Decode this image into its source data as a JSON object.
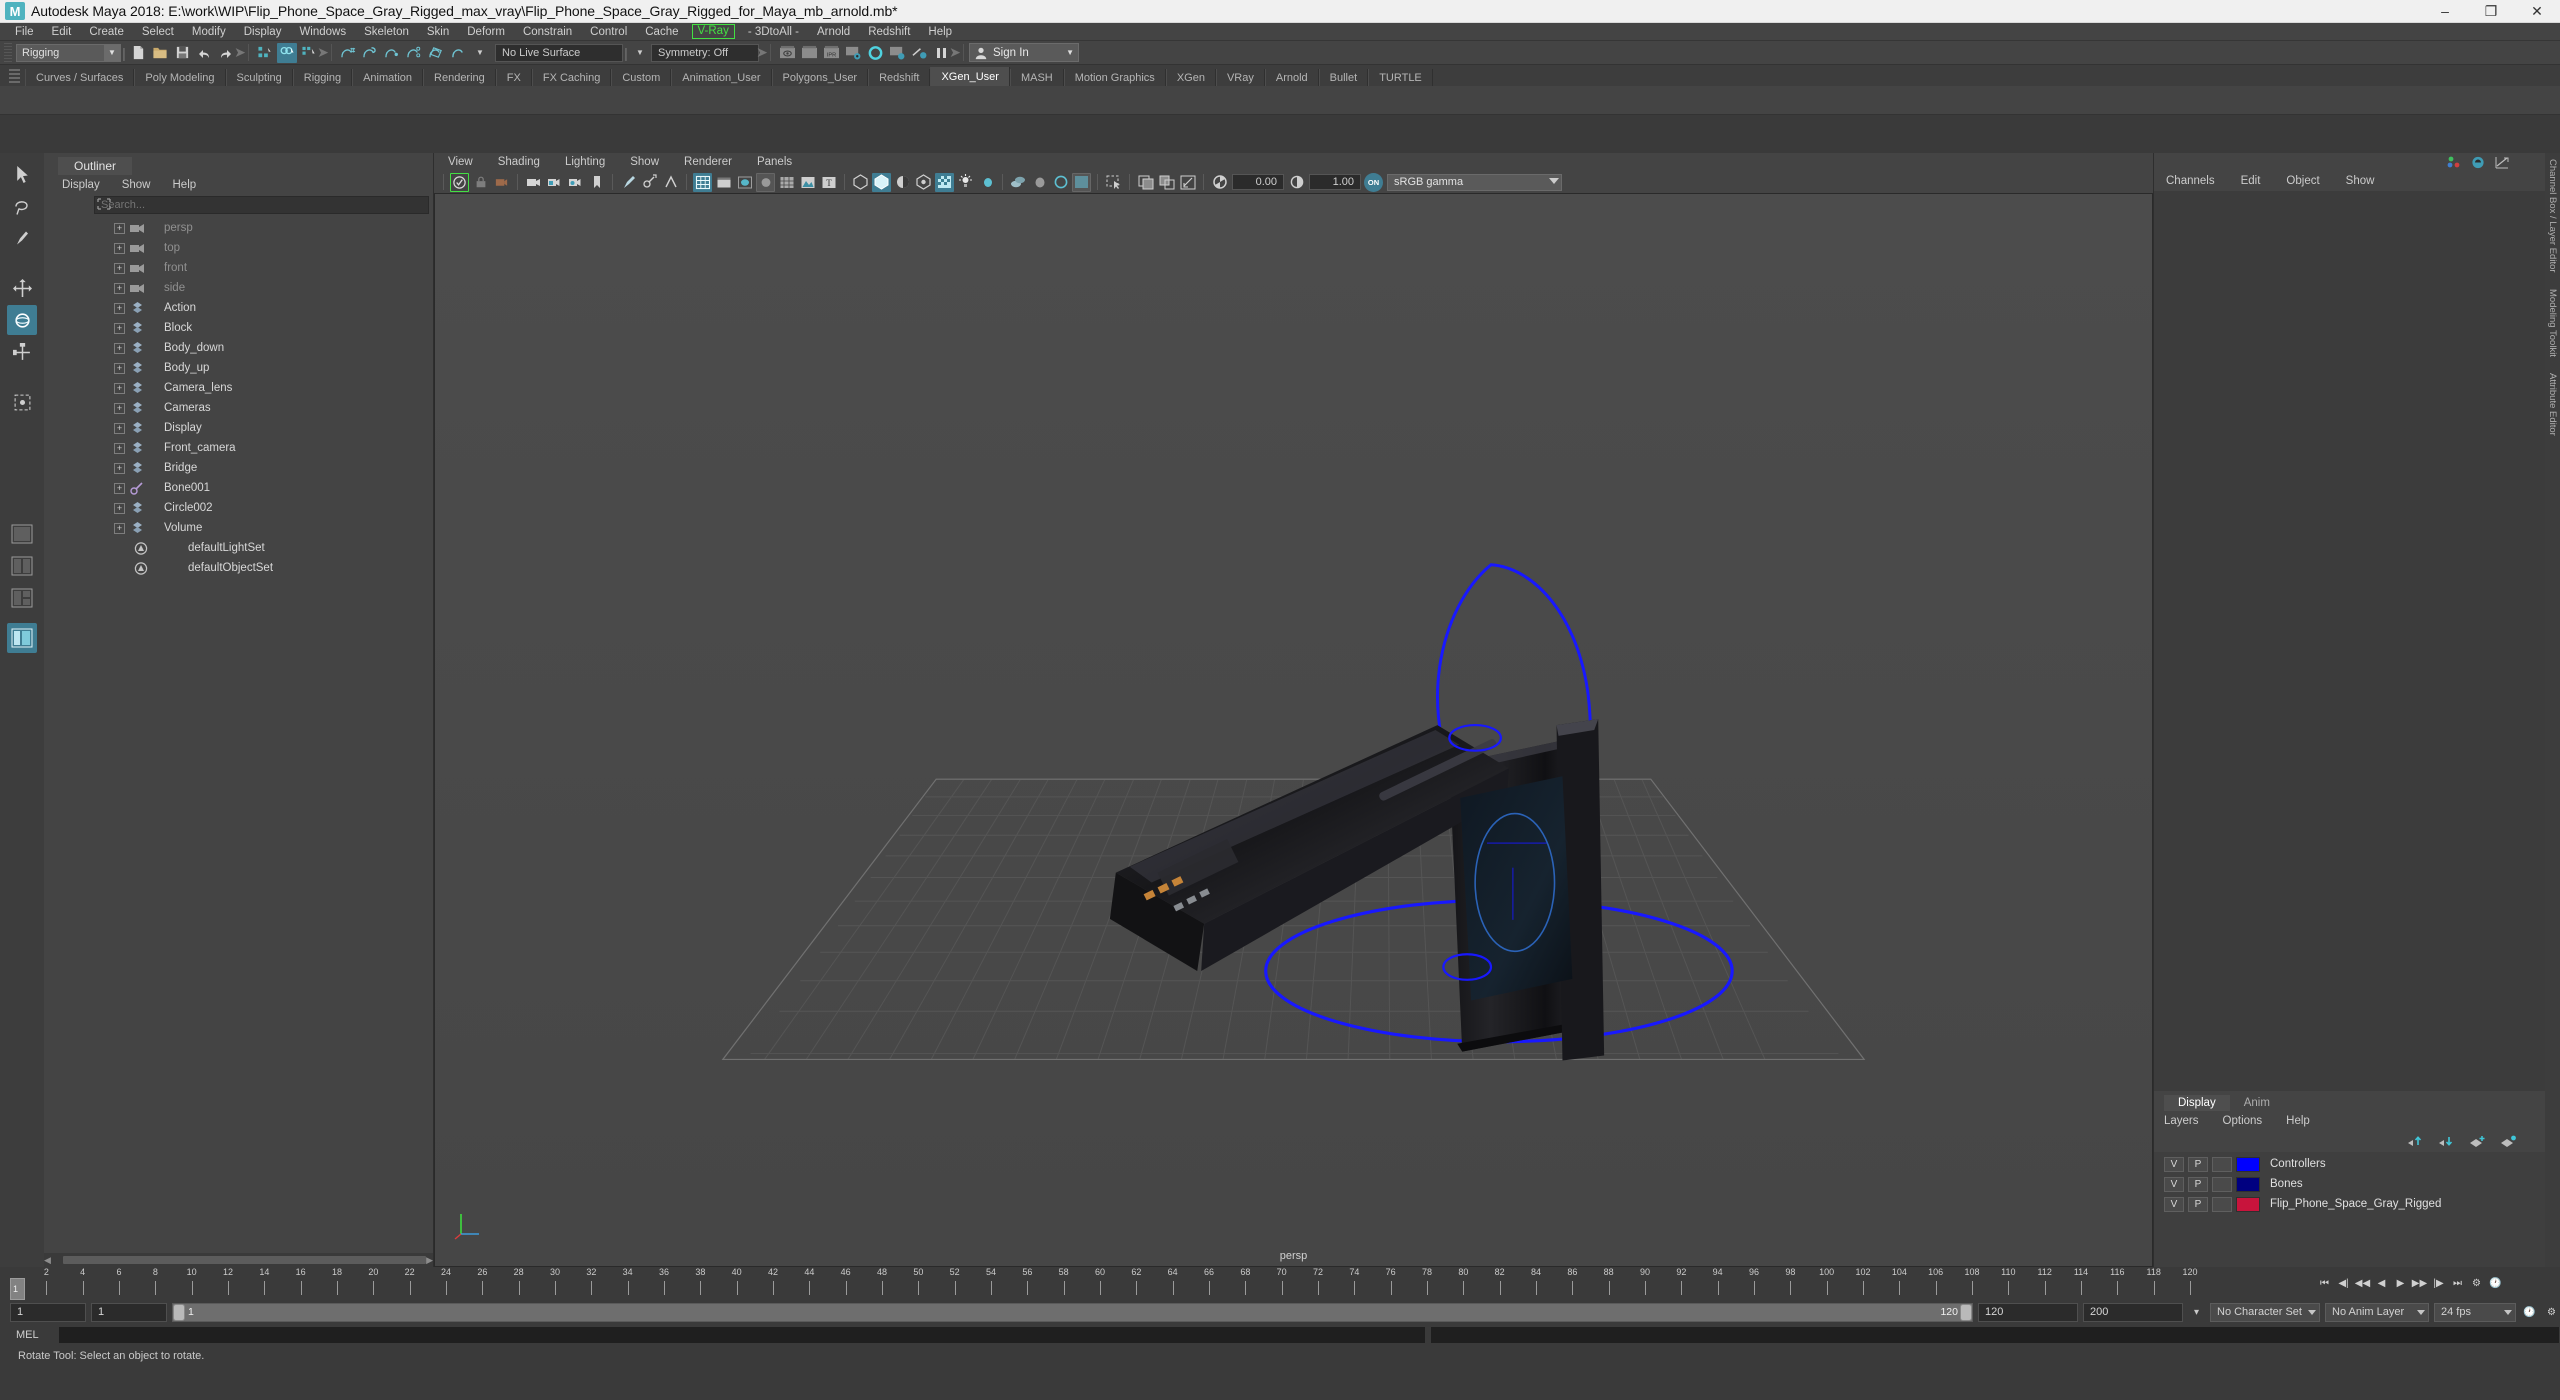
{
  "window": {
    "app_icon": "M",
    "title": "Autodesk Maya 2018: E:\\work\\WIP\\Flip_Phone_Space_Gray_Rigged_max_vray\\Flip_Phone_Space_Gray_Rigged_for_Maya_mb_arnold.mb*",
    "minimize": "–",
    "maximize": "❐",
    "close": "✕"
  },
  "menubar": [
    {
      "label": "File"
    },
    {
      "label": "Edit"
    },
    {
      "label": "Create"
    },
    {
      "label": "Select"
    },
    {
      "label": "Modify"
    },
    {
      "label": "Display"
    },
    {
      "label": "Windows"
    },
    {
      "label": "Skeleton"
    },
    {
      "label": "Skin"
    },
    {
      "label": "Deform"
    },
    {
      "label": "Constrain"
    },
    {
      "label": "Control"
    },
    {
      "label": "Cache"
    },
    {
      "label": "V-Ray",
      "style": "vray"
    },
    {
      "label": "- 3DtoAll -"
    },
    {
      "label": "Arnold"
    },
    {
      "label": "Redshift"
    },
    {
      "label": "Help"
    }
  ],
  "statusbar": {
    "menuset": "Rigging",
    "live_surface": "No Live Surface",
    "symmetry": "Symmetry: Off",
    "signin": "Sign In"
  },
  "shelf": {
    "tabs": [
      {
        "label": "Curves / Surfaces"
      },
      {
        "label": "Poly Modeling"
      },
      {
        "label": "Sculpting"
      },
      {
        "label": "Rigging"
      },
      {
        "label": "Animation"
      },
      {
        "label": "Rendering"
      },
      {
        "label": "FX"
      },
      {
        "label": "FX Caching"
      },
      {
        "label": "Custom"
      },
      {
        "label": "Animation_User"
      },
      {
        "label": "Polygons_User"
      },
      {
        "label": "Redshift"
      },
      {
        "label": "XGen_User",
        "active": true
      },
      {
        "label": "MASH"
      },
      {
        "label": "Motion Graphics"
      },
      {
        "label": "XGen"
      },
      {
        "label": "VRay"
      },
      {
        "label": "Arnold"
      },
      {
        "label": "Bullet"
      },
      {
        "label": "TURTLE"
      }
    ]
  },
  "outliner": {
    "tab": "Outliner",
    "menus": [
      "Display",
      "Show",
      "Help"
    ],
    "search_placeholder": "Search...",
    "items": [
      {
        "label": "persp",
        "icon": "camera-icon",
        "dim": true,
        "expandable": true
      },
      {
        "label": "top",
        "icon": "camera-icon",
        "dim": true,
        "expandable": true
      },
      {
        "label": "front",
        "icon": "camera-icon",
        "dim": true,
        "expandable": true
      },
      {
        "label": "side",
        "icon": "camera-icon",
        "dim": true,
        "expandable": true
      },
      {
        "label": "Action",
        "icon": "transform-icon",
        "dim": false,
        "expandable": true
      },
      {
        "label": "Block",
        "icon": "transform-icon",
        "dim": false,
        "expandable": true
      },
      {
        "label": "Body_down",
        "icon": "transform-icon",
        "dim": false,
        "expandable": true
      },
      {
        "label": "Body_up",
        "icon": "transform-icon",
        "dim": false,
        "expandable": true
      },
      {
        "label": "Camera_lens",
        "icon": "transform-icon",
        "dim": false,
        "expandable": true
      },
      {
        "label": "Cameras",
        "icon": "transform-icon",
        "dim": false,
        "expandable": true
      },
      {
        "label": "Display",
        "icon": "transform-icon",
        "dim": false,
        "expandable": true
      },
      {
        "label": "Front_camera",
        "icon": "transform-icon",
        "dim": false,
        "expandable": true
      },
      {
        "label": "Bridge",
        "icon": "transform-icon",
        "dim": false,
        "expandable": true
      },
      {
        "label": "Bone001",
        "icon": "joint-icon",
        "dim": false,
        "expandable": true
      },
      {
        "label": "Circle002",
        "icon": "transform-icon",
        "dim": false,
        "expandable": true
      },
      {
        "label": "Volume",
        "icon": "transform-icon",
        "dim": false,
        "expandable": true
      },
      {
        "label": "defaultLightSet",
        "icon": "set-icon",
        "dim": false,
        "expandable": false
      },
      {
        "label": "defaultObjectSet",
        "icon": "set-icon",
        "dim": false,
        "expandable": false
      }
    ]
  },
  "viewport": {
    "menus": [
      "View",
      "Shading",
      "Lighting",
      "Show",
      "Renderer",
      "Panels"
    ],
    "exposure": "0.00",
    "gamma": "1.00",
    "colormgmt_toggle": "ON",
    "color_profile": "sRGB gamma",
    "camera_label": "persp"
  },
  "channelbox": {
    "menus": [
      "Channels",
      "Edit",
      "Object",
      "Show"
    ]
  },
  "layers": {
    "tabs": [
      {
        "label": "Display",
        "active": true
      },
      {
        "label": "Anim",
        "active": false
      }
    ],
    "menus": [
      "Layers",
      "Options",
      "Help"
    ],
    "columns": [
      "V",
      "P",
      ""
    ],
    "rows": [
      {
        "visible": "V",
        "playback": "P",
        "type": "",
        "color": "#0000ff",
        "name": "Controllers"
      },
      {
        "visible": "V",
        "playback": "P",
        "type": "",
        "color": "#000080",
        "name": "Bones"
      },
      {
        "visible": "V",
        "playback": "P",
        "type": "",
        "color": "#c8143c",
        "name": "Flip_Phone_Space_Gray_Rigged"
      }
    ]
  },
  "right_tabs": [
    "Channel Box / Layer Editor",
    "Modeling Toolkit",
    "Attribute Editor"
  ],
  "timeline": {
    "current_frame": "1",
    "ticks": [
      2,
      4,
      6,
      8,
      10,
      12,
      14,
      16,
      18,
      20,
      22,
      24,
      26,
      28,
      30,
      32,
      34,
      36,
      38,
      40,
      42,
      44,
      46,
      48,
      50,
      52,
      54,
      56,
      58,
      60,
      62,
      64,
      66,
      68,
      70,
      72,
      74,
      76,
      78,
      80,
      82,
      84,
      86,
      88,
      90,
      92,
      94,
      96,
      98,
      100,
      102,
      104,
      106,
      108,
      110,
      112,
      114,
      116,
      118,
      120
    ],
    "field_right": "1"
  },
  "range": {
    "start": "1",
    "playback_start": "1",
    "bar_start": "1",
    "bar_end": "120",
    "playback_end": "120",
    "end": "200",
    "character_set": "No Character Set",
    "anim_layer": "No Anim Layer",
    "fps": "24 fps"
  },
  "command_line": {
    "language": "MEL",
    "input_value": "",
    "input_placeholder": ""
  },
  "help_line": {
    "text": "Rotate Tool: Select an object to rotate."
  },
  "colors": {
    "accent_teal": "#3f9cb5",
    "vray_green": "#43e043",
    "controller_blue": "#0000ff",
    "panel_bg": "#444444",
    "viewport_bg": "#4a4a4a"
  }
}
